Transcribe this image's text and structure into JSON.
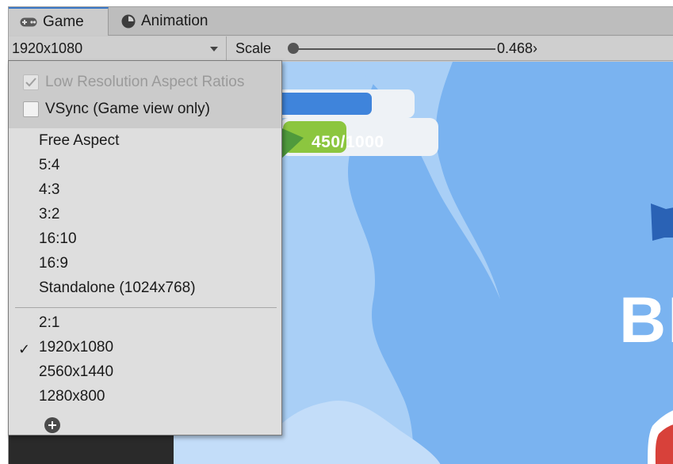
{
  "tabs": [
    {
      "label": "Game",
      "icon": "gamepad-icon",
      "active": true
    },
    {
      "label": "Animation",
      "icon": "animation-clock-icon",
      "active": false
    }
  ],
  "toolbar": {
    "resolution": "1920x1080",
    "scale_label": "Scale",
    "scale_value": "0.468›"
  },
  "viewport": {
    "score_text": "450/1000",
    "partial_title": "BI"
  },
  "menu": {
    "options": [
      {
        "label": "Low Resolution Aspect Ratios",
        "checked": true,
        "disabled": true
      },
      {
        "label": "VSync (Game view only)",
        "checked": false,
        "disabled": false
      }
    ],
    "aspects": [
      "Free Aspect",
      "5:4",
      "4:3",
      "3:2",
      "16:10",
      "16:9",
      "Standalone (1024x768)"
    ],
    "resolutions": [
      "2:1",
      "1920x1080",
      "2560x1440",
      "1280x800"
    ],
    "selected": "1920x1080",
    "checkmark": "✓"
  },
  "colors": {
    "accent": "#3a78c8",
    "sky": "#7ab3f0",
    "bar_blue": "#3f84db",
    "bar_green": "#8cc63f",
    "diamond_green": "#4f9a3c"
  }
}
